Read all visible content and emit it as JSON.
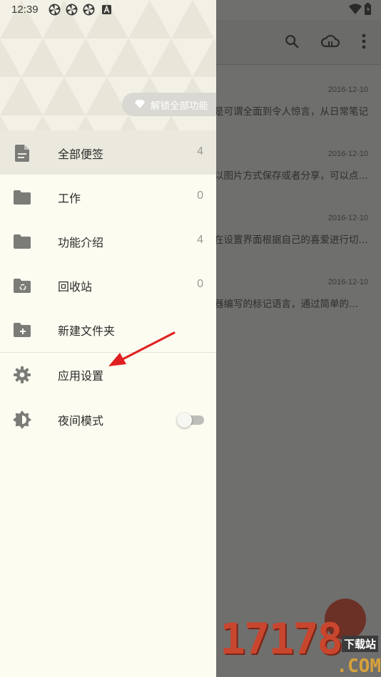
{
  "status_bar": {
    "time": "12:39",
    "icons": [
      "pinwheel-icon",
      "pinwheel-icon",
      "pinwheel-icon",
      "a-icon",
      "wifi-icon",
      "battery-icon"
    ]
  },
  "toolbar": {
    "icons": [
      "search-icon",
      "cloud-sync-icon",
      "more-vertical-icon"
    ]
  },
  "notes": [
    {
      "date": "2016-12-10",
      "preview": "是可谓全面到令人惊言，从日常笔记..."
    },
    {
      "date": "2016-12-10",
      "preview": "以图片方式保存或者分享，可以点..."
    },
    {
      "date": "2016-12-10",
      "preview": "在设置界面根据自己的喜爱进行切..."
    },
    {
      "date": "2016-12-10",
      "preview": "器编写的标记语言，通过简单的..."
    }
  ],
  "drawer": {
    "unlock_label": "解锁全部功能",
    "items": [
      {
        "label": "全部便签",
        "count": "4",
        "icon": "note-icon",
        "active": true
      },
      {
        "label": "工作",
        "count": "0",
        "icon": "folder-icon"
      },
      {
        "label": "功能介绍",
        "count": "4",
        "icon": "folder-icon"
      },
      {
        "label": "回收站",
        "count": "0",
        "icon": "recycle-folder-icon"
      },
      {
        "label": "新建文件夹",
        "icon": "add-folder-icon"
      },
      {
        "label": "应用设置",
        "icon": "gear-icon"
      },
      {
        "label": "夜间模式",
        "icon": "brightness-icon"
      }
    ],
    "night_mode_on": false
  },
  "watermark": {
    "digits": "17178",
    "sub": "下载站",
    "com": ".COM"
  },
  "colors": {
    "drawer_bg": "#fdfcf1",
    "active_row": "#ebe9de",
    "scrim": "#6f6f6d",
    "arrow": "#e02020"
  }
}
